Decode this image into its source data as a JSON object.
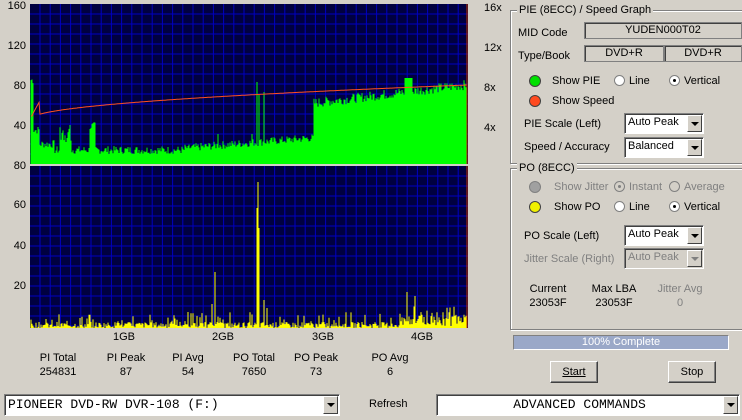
{
  "colors": {
    "plot_bg": "#000040",
    "grid": "#0000c0",
    "pie": "#00ff00",
    "speed": "#ff5020",
    "po": "#ffff00",
    "show_pie_dot": "#00e000",
    "show_speed_dot": "#ff4a20",
    "show_po_dot": "#f0f000",
    "jitter_dot": "#a0a0a0",
    "progress": "#9aa8c8"
  },
  "top_graph": {
    "left_ticks": [
      "160",
      "120",
      "80",
      "40"
    ],
    "right_ticks": [
      "16x",
      "12x",
      "8x",
      "4x"
    ]
  },
  "bottom_graph": {
    "left_ticks": [
      "80",
      "60",
      "40",
      "20"
    ]
  },
  "x_axis": {
    "ticks": [
      "1GB",
      "2GB",
      "3GB",
      "4GB"
    ]
  },
  "stats": [
    {
      "label": "PI Total",
      "value": "254831"
    },
    {
      "label": "PI Peak",
      "value": "87"
    },
    {
      "label": "PI Avg",
      "value": "54"
    },
    {
      "label": "PO Total",
      "value": "7650"
    },
    {
      "label": "PO Peak",
      "value": "73"
    },
    {
      "label": "PO Avg",
      "value": "6"
    }
  ],
  "pie_panel": {
    "title": "PIE (8ECC) / Speed Graph",
    "mid_label": "MID Code",
    "mid_value": "YUDEN000T02",
    "typebook_label": "Type/Book",
    "type_value": "DVD+R",
    "book_value": "DVD+R",
    "show_pie": "Show PIE",
    "line": "Line",
    "vertical": "Vertical",
    "show_speed": "Show Speed",
    "pie_scale_label": "PIE Scale (Left)",
    "pie_scale_value": "Auto Peak",
    "speed_label": "Speed / Accuracy",
    "speed_value": "Balanced"
  },
  "po_panel": {
    "title": "PO (8ECC)",
    "show_jitter": "Show Jitter",
    "instant": "Instant",
    "average": "Average",
    "show_po": "Show PO",
    "line": "Line",
    "vertical": "Vertical",
    "po_scale_label": "PO Scale (Left)",
    "po_scale_value": "Auto Peak",
    "jitter_scale_label": "Jitter Scale (Right)",
    "jitter_scale_value": "Auto Peak",
    "current_label": "Current",
    "current_value": "23053F",
    "maxlba_label": "Max LBA",
    "maxlba_value": "23053F",
    "jitter_avg_label": "Jitter Avg",
    "jitter_avg_value": "0"
  },
  "progress": {
    "text": "100% Complete",
    "value": 1.0
  },
  "buttons": {
    "start": "Start",
    "stop": "Stop",
    "refresh": "Refresh"
  },
  "drive_select": "PIONEER DVD-RW  DVR-108  (F:)",
  "commands_select": "ADVANCED COMMANDS"
}
